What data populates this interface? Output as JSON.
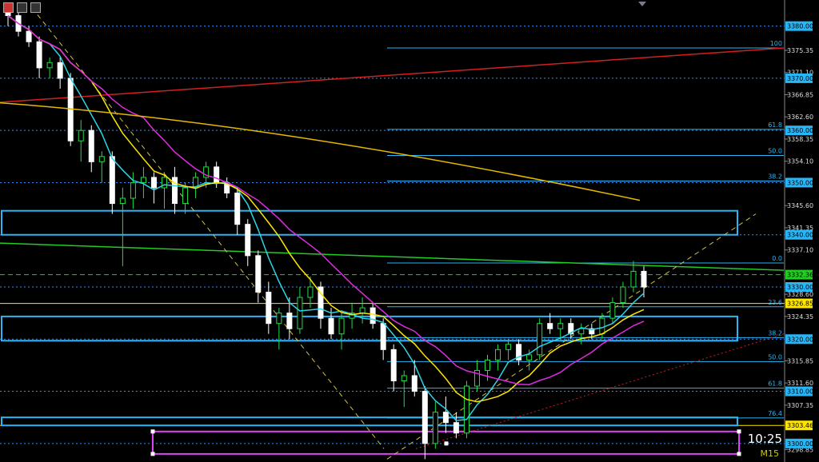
{
  "window": {
    "clock": "10:25",
    "timeframe": "M15"
  },
  "colors": {
    "grid": "#2f8fff",
    "candle_up": "#22dd44",
    "candle_down": "#ffffff",
    "cyan_ma": "#2bd4e6",
    "magenta_ma": "#e02be0",
    "yellow_ma": "#ffe600",
    "gold_ma": "#e6b800",
    "red_trend": "#d02020",
    "green_line": "#22cc22",
    "zone_box": "#29b6f6",
    "pink_box": "#e040fb"
  },
  "chart_data": {
    "type": "candlestick",
    "ylim": [
      3296.45,
      3385.0
    ],
    "yticks": [
      3375.35,
      3371.1,
      3366.85,
      3362.6,
      3358.35,
      3354.1,
      3345.6,
      3341.35,
      3337.1,
      3328.6,
      3324.35,
      3315.85,
      3311.6,
      3307.35,
      3298.85
    ],
    "price_labels": [
      {
        "text": "3380.00",
        "value": 3380.0,
        "bg": "#29b6f6"
      },
      {
        "text": "3370.00",
        "value": 3370.0,
        "bg": "#29b6f6"
      },
      {
        "text": "3360.00",
        "value": 3360.0,
        "bg": "#29b6f6"
      },
      {
        "text": "3350.00",
        "value": 3350.0,
        "bg": "#29b6f6"
      },
      {
        "text": "3340.00",
        "value": 3340.0,
        "bg": "#29b6f6"
      },
      {
        "text": "3332.36",
        "value": 3332.36,
        "bg": "#22cc22"
      },
      {
        "text": "3330.00",
        "value": 3330.0,
        "bg": "#29b6f6"
      },
      {
        "text": "3326.85",
        "value": 3326.85,
        "bg": "#ffe600"
      },
      {
        "text": "3320.00",
        "value": 3320.0,
        "bg": "#29b6f6"
      },
      {
        "text": "3310.00",
        "value": 3310.0,
        "bg": "#29b6f6"
      },
      {
        "text": "3303.46",
        "value": 3303.46,
        "bg": "#ffe600"
      },
      {
        "text": "3300.00",
        "value": 3300.0,
        "bg": "#29b6f6"
      }
    ],
    "fib_levels": [
      {
        "label": "100",
        "value": 3375.8
      },
      {
        "label": "61.8",
        "value": 3360.2
      },
      {
        "label": "50.0",
        "value": 3355.2
      },
      {
        "label": "38.2",
        "value": 3350.3
      },
      {
        "label": "0.0",
        "value": 3334.6
      },
      {
        "label": "23.6",
        "value": 3326.2
      },
      {
        "label": "38.2",
        "value": 3320.3
      },
      {
        "label": "50.0",
        "value": 3315.7
      },
      {
        "label": "61.8",
        "value": 3310.6
      },
      {
        "label": "76.4",
        "value": 3304.9
      }
    ],
    "candles": [
      [
        3383,
        3384,
        3380,
        3382
      ],
      [
        3382,
        3383,
        3378,
        3379
      ],
      [
        3379,
        3380,
        3376,
        3377
      ],
      [
        3377,
        3378,
        3370,
        3372
      ],
      [
        3372,
        3374,
        3370,
        3373
      ],
      [
        3373,
        3374,
        3368,
        3370
      ],
      [
        3370,
        3371,
        3357,
        3358
      ],
      [
        3358,
        3362,
        3354,
        3360
      ],
      [
        3360,
        3361,
        3352,
        3354
      ],
      [
        3354,
        3356,
        3350,
        3355
      ],
      [
        3355,
        3356,
        3344,
        3346
      ],
      [
        3346,
        3349,
        3334,
        3347
      ],
      [
        3347,
        3352,
        3345,
        3350
      ],
      [
        3350,
        3353,
        3347,
        3351
      ],
      [
        3351,
        3352,
        3346,
        3349
      ],
      [
        3349,
        3352,
        3345,
        3351
      ],
      [
        3351,
        3353,
        3344,
        3346
      ],
      [
        3346,
        3350,
        3344,
        3349
      ],
      [
        3349,
        3352,
        3347,
        3351
      ],
      [
        3351,
        3354,
        3349,
        3353
      ],
      [
        3353,
        3354,
        3349,
        3350
      ],
      [
        3350,
        3351,
        3347,
        3348
      ],
      [
        3348,
        3349,
        3340,
        3342
      ],
      [
        3342,
        3343,
        3334,
        3336
      ],
      [
        3336,
        3337,
        3327,
        3329
      ],
      [
        3329,
        3331,
        3321,
        3323
      ],
      [
        3323,
        3326,
        3318,
        3325
      ],
      [
        3325,
        3328,
        3320,
        3322
      ],
      [
        3322,
        3330,
        3321,
        3328
      ],
      [
        3328,
        3332,
        3326,
        3330
      ],
      [
        3330,
        3331,
        3322,
        3324
      ],
      [
        3324,
        3326,
        3320,
        3321
      ],
      [
        3321,
        3325,
        3318,
        3324
      ],
      [
        3324,
        3327,
        3322,
        3325
      ],
      [
        3325,
        3328,
        3323,
        3326
      ],
      [
        3326,
        3327,
        3322,
        3323
      ],
      [
        3323,
        3324,
        3316,
        3318
      ],
      [
        3318,
        3319,
        3310,
        3312
      ],
      [
        3312,
        3314,
        3307,
        3313
      ],
      [
        3313,
        3316,
        3309,
        3310
      ],
      [
        3310,
        3311,
        3297,
        3300
      ],
      [
        3300,
        3308,
        3299,
        3306
      ],
      [
        3306,
        3309,
        3302,
        3304
      ],
      [
        3304,
        3306,
        3301,
        3302
      ],
      [
        3302,
        3312,
        3301,
        3311
      ],
      [
        3311,
        3316,
        3310,
        3314
      ],
      [
        3314,
        3317,
        3312,
        3316
      ],
      [
        3316,
        3319,
        3314,
        3318
      ],
      [
        3318,
        3320,
        3316,
        3319
      ],
      [
        3319,
        3320,
        3315,
        3316
      ],
      [
        3316,
        3318,
        3314,
        3317
      ],
      [
        3317,
        3324,
        3316,
        3323
      ],
      [
        3323,
        3325,
        3321,
        3322
      ],
      [
        3322,
        3324,
        3320,
        3323
      ],
      [
        3323,
        3324,
        3320,
        3321
      ],
      [
        3321,
        3323,
        3319,
        3322
      ],
      [
        3322,
        3323,
        3320,
        3321
      ],
      [
        3321,
        3325,
        3320,
        3324
      ],
      [
        3324,
        3328,
        3323,
        3327
      ],
      [
        3327,
        3331,
        3326,
        3330
      ],
      [
        3330,
        3335,
        3329,
        3333
      ],
      [
        3333,
        3334,
        3328,
        3330
      ]
    ]
  }
}
